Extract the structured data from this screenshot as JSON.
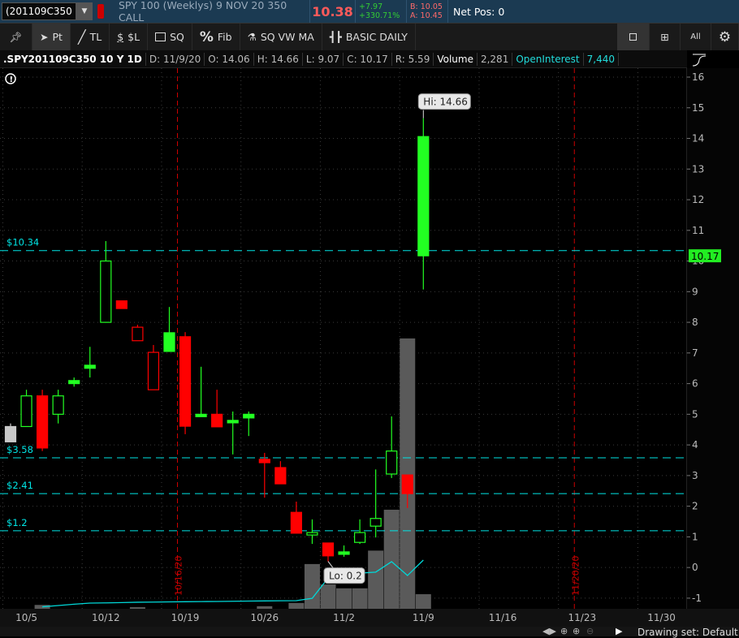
{
  "header": {
    "symbol": "(201109C350",
    "description": "SPY 100 (Weeklys) 9 NOV 20 350 CALL",
    "last": "10.38",
    "change": "+7.97",
    "change_pct": "+330.71%",
    "bid": "B: 10.05",
    "ask": "A: 10.45",
    "net_pos": "Net Pos: 0"
  },
  "toolbar": {
    "pin": "",
    "pt": "Pt",
    "tl": "TL",
    "dollar_l": "$L",
    "sq": "SQ",
    "fib": "Fib",
    "sqvwma": "SQ VW MA",
    "basic_daily": "BASIC DAILY",
    "all": "All"
  },
  "info": {
    "symbol": ".SPY201109C350 10 Y 1D",
    "date": "D: 11/9/20",
    "open": "O: 14.06",
    "high": "H: 14.66",
    "low": "L: 9.07",
    "close": "C: 10.17",
    "range": "R: 5.59",
    "volume_label": "Volume",
    "volume": "2,281",
    "oi_label": "OpenInterest",
    "oi": "7,440"
  },
  "colors": {
    "up": "#22ff22",
    "down": "#ff0000",
    "level": "#00e5e5",
    "volume": "#5a5a5a",
    "oi": "#00d8d8"
  },
  "chart_data": {
    "type": "candlestick",
    "ylim": [
      -1,
      16
    ],
    "y_ticks": [
      16,
      15,
      14,
      13,
      12,
      11,
      10,
      9,
      8,
      7,
      6,
      5,
      4,
      3,
      2,
      1,
      0,
      -1
    ],
    "x_labels": [
      {
        "i": 1,
        "t": "10/5"
      },
      {
        "i": 6,
        "t": "10/12"
      },
      {
        "i": 11,
        "t": "10/19"
      },
      {
        "i": 16,
        "t": "10/26"
      },
      {
        "i": 21,
        "t": "11/2"
      },
      {
        "i": 26,
        "t": "11/9"
      },
      {
        "i": 31,
        "t": "11/16"
      },
      {
        "i": 36,
        "t": "11/23"
      },
      {
        "i": 41,
        "t": "11/30"
      }
    ],
    "candles": [
      {
        "o": 4.6,
        "h": 4.7,
        "l": 4.1,
        "c": 4.1,
        "col": "gray",
        "fill": true
      },
      {
        "o": 4.6,
        "h": 5.8,
        "l": 4.6,
        "c": 5.6,
        "col": "up",
        "fill": false
      },
      {
        "o": 5.6,
        "h": 5.8,
        "l": 3.8,
        "c": 3.9,
        "col": "down",
        "fill": true
      },
      {
        "o": 5.0,
        "h": 5.8,
        "l": 4.7,
        "c": 5.6,
        "col": "up",
        "fill": false
      },
      {
        "o": 6.0,
        "h": 6.2,
        "l": 5.9,
        "c": 6.1,
        "col": "up",
        "fill": true
      },
      {
        "o": 6.5,
        "h": 7.2,
        "l": 6.2,
        "c": 6.6,
        "col": "up",
        "fill": true
      },
      {
        "o": 8.0,
        "h": 10.65,
        "l": 8.0,
        "c": 10.0,
        "col": "up",
        "fill": false
      },
      {
        "o": 8.7,
        "h": 8.7,
        "l": 8.45,
        "c": 8.45,
        "col": "down",
        "fill": true
      },
      {
        "o": 7.4,
        "h": 7.92,
        "l": 7.4,
        "c": 7.84,
        "col": "down",
        "fill": false
      },
      {
        "o": 5.8,
        "h": 7.26,
        "l": 5.8,
        "c": 7.02,
        "col": "down",
        "fill": false
      },
      {
        "o": 7.05,
        "h": 8.5,
        "l": 7.05,
        "c": 7.66,
        "col": "up",
        "fill": true
      },
      {
        "o": 7.53,
        "h": 7.68,
        "l": 4.35,
        "c": 4.61,
        "col": "down",
        "fill": true
      },
      {
        "o": 5.0,
        "h": 6.55,
        "l": 4.93,
        "c": 5.0,
        "col": "up",
        "fill": true
      },
      {
        "o": 5.0,
        "h": 5.8,
        "l": 4.59,
        "c": 4.59,
        "col": "down",
        "fill": true
      },
      {
        "o": 4.8,
        "h": 5.09,
        "l": 3.69,
        "c": 4.8,
        "col": "up",
        "fill": true
      },
      {
        "o": 4.88,
        "h": 5.09,
        "l": 4.29,
        "c": 5.0,
        "col": "up",
        "fill": true
      },
      {
        "o": 3.53,
        "h": 3.74,
        "l": 2.28,
        "c": 3.42,
        "col": "down",
        "fill": true
      },
      {
        "o": 3.26,
        "h": 3.47,
        "l": 2.73,
        "c": 2.73,
        "col": "down",
        "fill": true
      },
      {
        "o": 1.8,
        "h": 2.15,
        "l": 1.12,
        "c": 1.12,
        "col": "down",
        "fill": true
      },
      {
        "o": 1.09,
        "h": 1.57,
        "l": 0.77,
        "c": 1.14,
        "col": "up",
        "fill": false
      },
      {
        "o": 0.8,
        "h": 0.8,
        "l": 0.2,
        "c": 0.38,
        "col": "down",
        "fill": true
      },
      {
        "o": 0.43,
        "h": 0.72,
        "l": 0.35,
        "c": 0.51,
        "col": "up",
        "fill": true
      },
      {
        "o": 0.82,
        "h": 1.57,
        "l": 0.77,
        "c": 1.14,
        "col": "up",
        "fill": false
      },
      {
        "o": 1.35,
        "h": 3.2,
        "l": 0.98,
        "c": 1.6,
        "col": "up",
        "fill": false
      },
      {
        "o": 3.05,
        "h": 4.93,
        "l": 2.92,
        "c": 3.8,
        "col": "up",
        "fill": false
      },
      {
        "o": 3.02,
        "h": 3.02,
        "l": 1.94,
        "c": 2.41,
        "col": "down",
        "fill": true
      },
      {
        "o": 10.17,
        "h": 14.66,
        "l": 9.07,
        "c": 14.06,
        "col": "up",
        "fill": true
      }
    ],
    "volume": [
      0,
      0,
      600,
      0,
      0,
      0,
      0,
      0,
      250,
      0,
      0,
      0,
      0,
      0,
      0,
      0,
      400,
      0,
      900,
      7000,
      3800,
      3200,
      3200,
      9100,
      15500,
      42300,
      2281
    ],
    "open_interest": [
      0,
      0,
      300,
      500,
      700,
      870,
      900,
      950,
      1000,
      1020,
      1050,
      1080,
      1100,
      1120,
      1150,
      1180,
      1200,
      1220,
      1240,
      1600,
      4700,
      5200,
      5450,
      5600,
      7200,
      5080,
      7440
    ],
    "levels": [
      {
        "value": 10.34,
        "label": "$10.34"
      },
      {
        "value": 3.58,
        "label": "$3.58"
      },
      {
        "value": 2.41,
        "label": "$2.41"
      },
      {
        "value": 1.2,
        "label": "$1.2"
      }
    ],
    "markers": [
      {
        "i": 10,
        "label": "10/16/20"
      },
      {
        "i": 35,
        "label": "11/20/20"
      }
    ],
    "hi_label": "Hi: 14.66",
    "lo_label": "Lo: 0.2",
    "price_tag": "10.17"
  },
  "footer": {
    "drawing_set": "Drawing set: Default"
  }
}
